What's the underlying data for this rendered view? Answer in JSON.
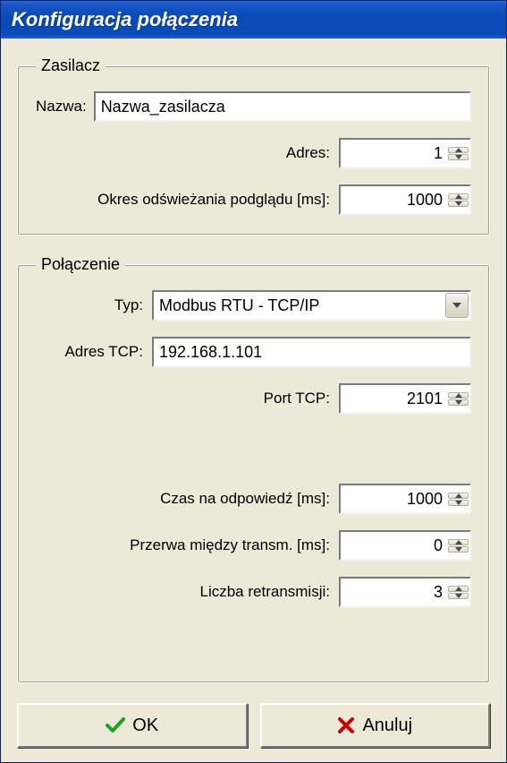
{
  "window": {
    "title": "Konfiguracja połączenia"
  },
  "group_zasilacz": {
    "legend": "Zasilacz",
    "nazwa_label": "Nazwa:",
    "nazwa_value": "Nazwa_zasilacza",
    "adres_label": "Adres:",
    "adres_value": "1",
    "okres_label": "Okres odświeżania podglądu [ms]:",
    "okres_value": "1000"
  },
  "group_polaczenie": {
    "legend": "Połączenie",
    "typ_label": "Typ:",
    "typ_value": "Modbus RTU - TCP/IP",
    "adres_tcp_label": "Adres TCP:",
    "adres_tcp_value": "192.168.1.101",
    "port_tcp_label": "Port TCP:",
    "port_tcp_value": "2101",
    "czas_odp_label": "Czas na odpowiedź [ms]:",
    "czas_odp_value": "1000",
    "przerwa_label": "Przerwa między transm. [ms]:",
    "przerwa_value": "0",
    "retrans_label": "Liczba retransmisji:",
    "retrans_value": "3"
  },
  "buttons": {
    "ok": "OK",
    "cancel": "Anuluj"
  }
}
